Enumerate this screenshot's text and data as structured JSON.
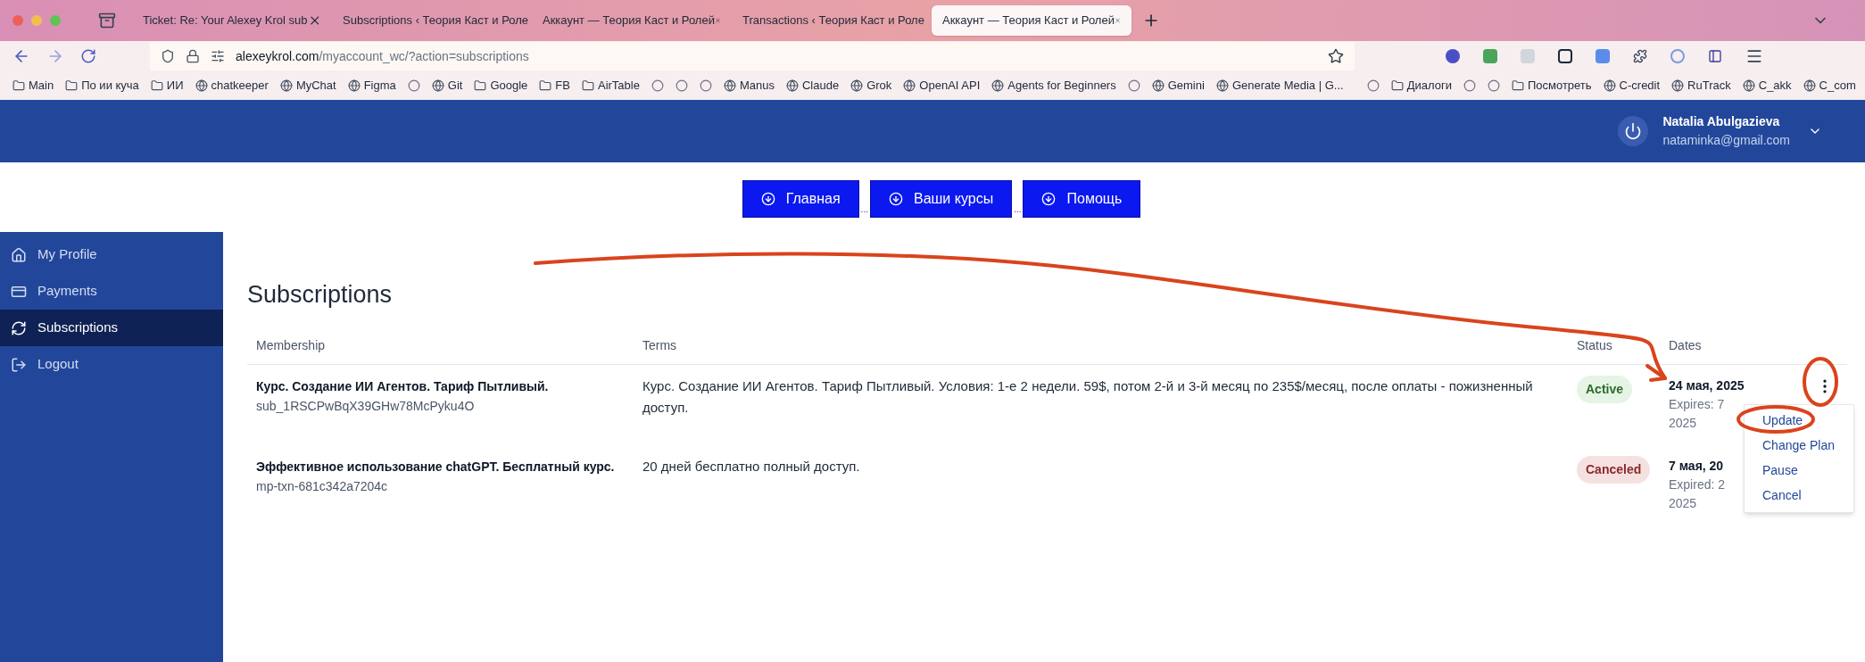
{
  "browser": {
    "tabs": [
      {
        "title": "Ticket: Re: Your Alexey Krol sub",
        "selected": false
      },
      {
        "title": "Subscriptions ‹ Теория Каст и Роле",
        "selected": false
      },
      {
        "title": "Аккаунт — Теория Каст и Ролей",
        "selected": false
      },
      {
        "title": "Transactions ‹ Теория Каст и Роле",
        "selected": false
      },
      {
        "title": "Аккаунт — Теория Каст и Ролей",
        "selected": true
      }
    ],
    "url": {
      "host": "alexeykrol.com",
      "path": "/myaccount_wc/?action=subscriptions"
    },
    "bookmarks": [
      {
        "kind": "folder",
        "label": "Main"
      },
      {
        "kind": "folder",
        "label": "По ии куча"
      },
      {
        "kind": "folder",
        "label": "ИИ"
      },
      {
        "kind": "site",
        "label": "chatkeeper"
      },
      {
        "kind": "site",
        "label": "MyChat"
      },
      {
        "kind": "site",
        "label": "Figma"
      },
      {
        "kind": "icon"
      },
      {
        "kind": "site",
        "label": "Git"
      },
      {
        "kind": "folder",
        "label": "Google"
      },
      {
        "kind": "folder",
        "label": "FB"
      },
      {
        "kind": "folder",
        "label": "AirTable"
      },
      {
        "kind": "icon"
      },
      {
        "kind": "icon"
      },
      {
        "kind": "icon"
      },
      {
        "kind": "site",
        "label": "Manus"
      },
      {
        "kind": "site",
        "label": "Claude"
      },
      {
        "kind": "site",
        "label": "Grok"
      },
      {
        "kind": "site",
        "label": "OpenAI API"
      },
      {
        "kind": "site",
        "label": "Agents for Beginners"
      },
      {
        "kind": "icon"
      },
      {
        "kind": "site",
        "label": "Gemini"
      },
      {
        "kind": "site",
        "label": "Generate Media | G..."
      },
      {
        "kind": "divider"
      },
      {
        "kind": "icon"
      },
      {
        "kind": "folder",
        "label": "Диалоги"
      },
      {
        "kind": "icon"
      },
      {
        "kind": "icon"
      },
      {
        "kind": "folder",
        "label": "Посмотреть"
      },
      {
        "kind": "site",
        "label": "C-credit"
      },
      {
        "kind": "site",
        "label": "RuTrack"
      },
      {
        "kind": "site",
        "label": "C_akk"
      },
      {
        "kind": "site",
        "label": "C_com"
      }
    ]
  },
  "header": {
    "user_name": "Natalia Abulgazieva",
    "email": "nataminka@gmail.com"
  },
  "nav": {
    "separator": "...",
    "buttons": [
      "Главная",
      "Ваши курсы",
      "Помощь"
    ]
  },
  "sidebar": {
    "items": [
      {
        "kind": "profile",
        "label": "My Profile",
        "selected": false
      },
      {
        "kind": "payments",
        "label": "Payments",
        "selected": false
      },
      {
        "kind": "subscriptions",
        "label": "Subscriptions",
        "selected": true
      },
      {
        "kind": "logout",
        "label": "Logout",
        "selected": false
      }
    ]
  },
  "page_title": "Subscriptions",
  "table": {
    "columns": [
      "Membership",
      "Terms",
      "Status",
      "Dates"
    ],
    "rows": [
      {
        "name": "Курс. Создание ИИ Агентов. Тариф Пытливый.",
        "id": "sub_1RSCPwBqX39GHw78McPyku4O",
        "terms": "Курс. Создание ИИ Агентов. Тариф Пытливый. Условия: 1-е 2 недели. 59$, потом 2-й и 3-й месяц по 235$/месяц, после оплаты - пожизненный доступ.",
        "status": {
          "kind": "active",
          "label": "Active"
        },
        "date": "24 мая, 2025",
        "date_note": "Expires: 7",
        "year": "2025",
        "menu_open": true
      },
      {
        "name": "Эффективное использование chatGPT. Бесплатный курс.",
        "id": "mp-txn-681c342a7204c",
        "terms": "20 дней бесплатно полный доступ.",
        "status": {
          "kind": "canceled",
          "label": "Canceled"
        },
        "date": "7 мая, 20",
        "date_note": "Expired: 2",
        "year": "2025",
        "menu_open": false
      }
    ]
  },
  "row_menu": {
    "items": [
      "Update",
      "Change Plan",
      "Pause",
      "Cancel"
    ]
  }
}
